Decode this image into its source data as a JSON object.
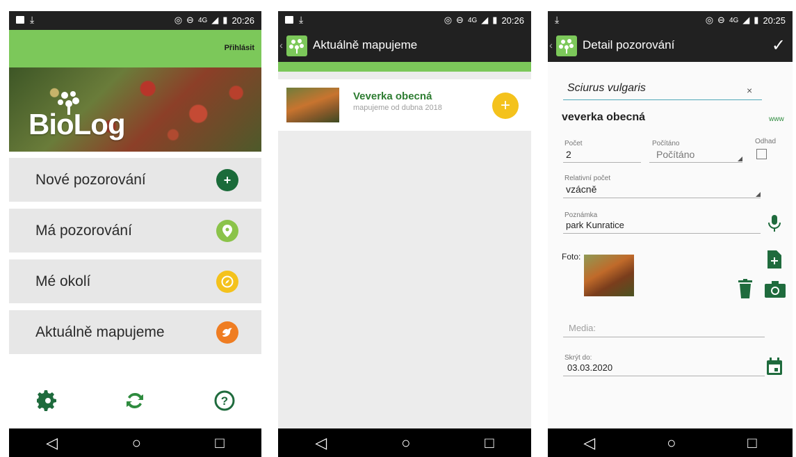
{
  "status": {
    "time1": "20:26",
    "time2": "20:26",
    "time3": "20:25",
    "network": "4G"
  },
  "screen1": {
    "login": "Přihlásit",
    "logo_text": "BioLog",
    "menu": [
      {
        "label": "Nové pozorování",
        "icon": "plus-icon",
        "color": "#1b6b3a"
      },
      {
        "label": "Má pozorování",
        "icon": "map-pin-icon",
        "color": "#8bc34a"
      },
      {
        "label": "Mé okolí",
        "icon": "compass-icon",
        "color": "#f4c21c"
      },
      {
        "label": "Aktuálně mapujeme",
        "icon": "bird-icon",
        "color": "#ef7d22"
      }
    ],
    "bottom_icons": [
      "settings-gear-icon",
      "sync-icon",
      "help-icon"
    ]
  },
  "screen2": {
    "title": "Aktuálně mapujeme",
    "item": {
      "name": "Veverka obecná",
      "subtitle": "mapujeme od dubna 2018"
    }
  },
  "screen3": {
    "title": "Detail pozorování",
    "scientific_name": "Sciurus vulgaris",
    "common_name": "veverka obecná",
    "www": "www",
    "count_label": "Počet",
    "count_value": "2",
    "counted_label": "Počítáno",
    "counted_value": "Počítáno",
    "estimate_label": "Odhad",
    "relative_label": "Relativní počet",
    "relative_value": "vzácně",
    "note_label": "Poznámka",
    "note_value": "park Kunratice",
    "photo_label": "Foto:",
    "media_placeholder": "Media:",
    "hide_label": "Skrýt do:",
    "hide_value": "03.03.2020"
  },
  "colors": {
    "accent_green": "#7cc85a",
    "dark_green": "#1f6b3d",
    "statusbar": "#212121"
  }
}
